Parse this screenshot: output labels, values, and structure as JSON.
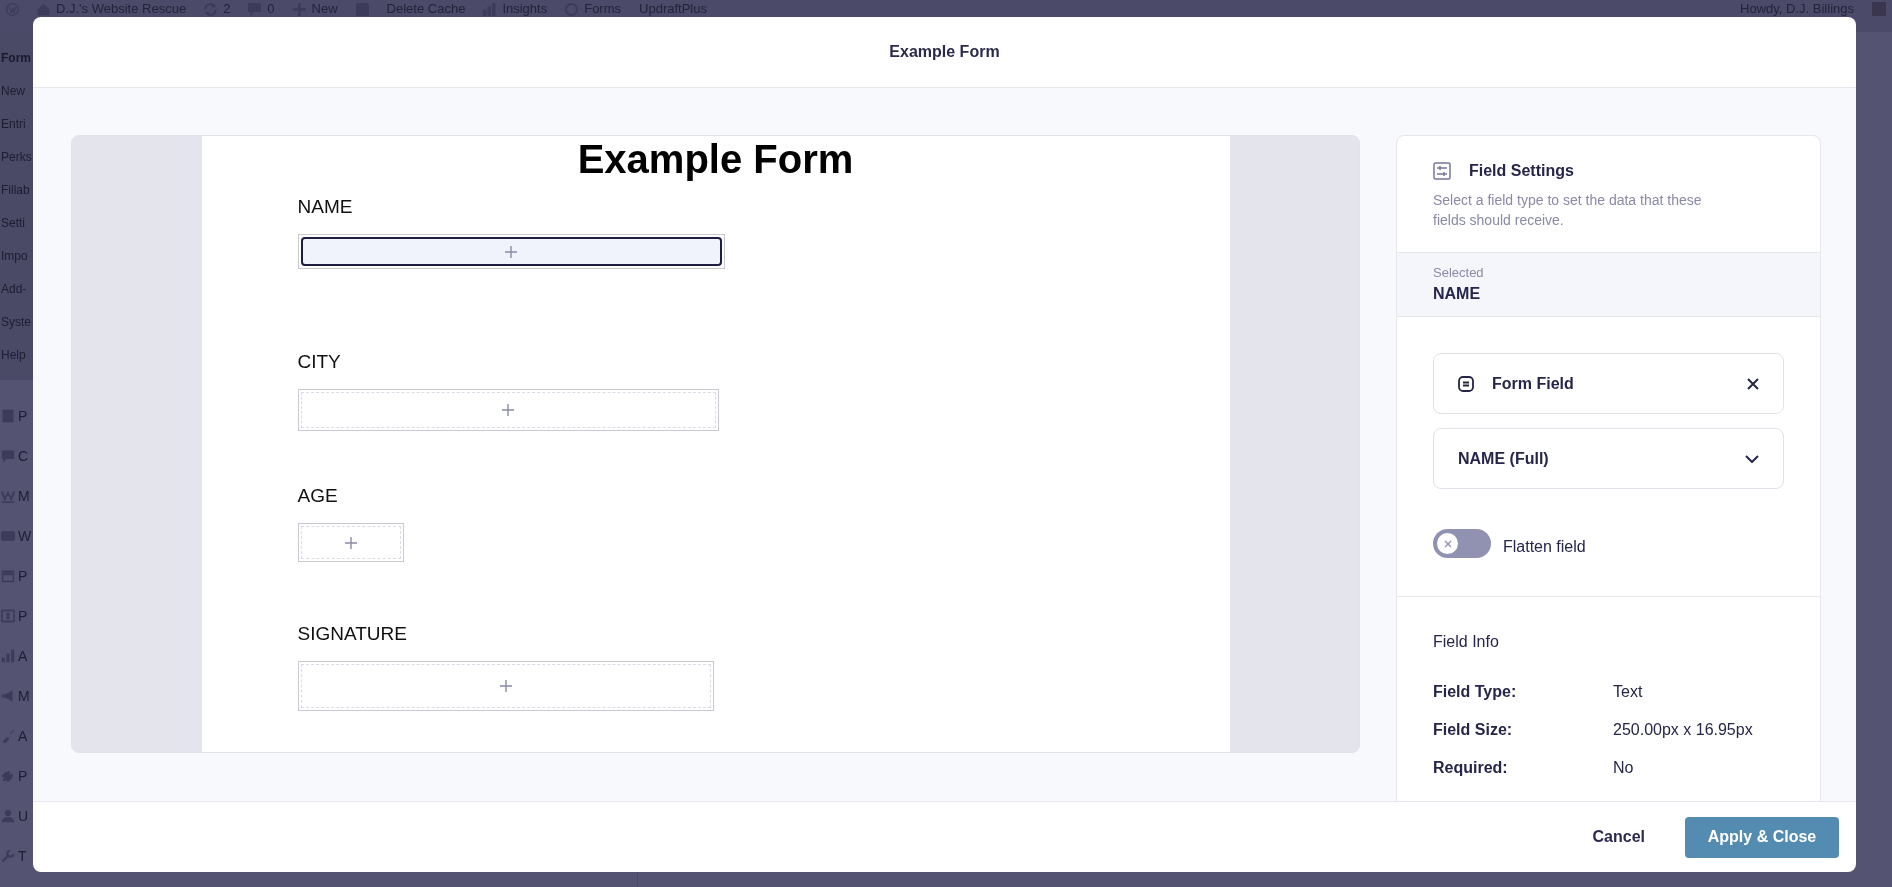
{
  "admin_bar": {
    "items": [
      {
        "kind": "wp-logo"
      },
      {
        "kind": "home",
        "label": "D.J.'s Website Rescue"
      },
      {
        "kind": "updates",
        "label": "2"
      },
      {
        "kind": "comments",
        "label": "0"
      },
      {
        "kind": "new",
        "label": "New"
      },
      {
        "kind": "seo"
      },
      {
        "kind": "text",
        "label": "Delete Cache"
      },
      {
        "kind": "insights",
        "label": "Insights"
      },
      {
        "kind": "forms",
        "label": "Forms"
      },
      {
        "kind": "text",
        "label": "UpdraftPlus"
      }
    ],
    "account": "Howdy, D.J. Billings"
  },
  "sidebar": {
    "submenu": [
      "Form",
      "New",
      "Entri",
      "Perks",
      "Fillab",
      "Setti",
      "Impo",
      "Add-",
      "Syste",
      "Help"
    ],
    "menu": [
      {
        "kind": "document",
        "label": "P"
      },
      {
        "kind": "bubble",
        "label": "C"
      },
      {
        "kind": "envelope",
        "label": "M"
      },
      {
        "kind": "shop",
        "label": "W"
      },
      {
        "kind": "box",
        "label": "P"
      },
      {
        "kind": "dollar",
        "label": "P"
      },
      {
        "kind": "bars",
        "label": "A"
      },
      {
        "kind": "megaphone",
        "label": "M"
      },
      {
        "kind": "brush",
        "label": "A"
      },
      {
        "kind": "plug",
        "label": "P"
      },
      {
        "kind": "person",
        "label": "U"
      },
      {
        "kind": "wrench",
        "label": "T"
      }
    ]
  },
  "modal": {
    "title": "Example Form",
    "document": {
      "title": "Example Form",
      "fields": [
        {
          "label": "NAME",
          "selected": true
        },
        {
          "label": "CITY",
          "selected": false
        },
        {
          "label": "AGE",
          "selected": false
        },
        {
          "label": "SIGNATURE",
          "selected": false
        }
      ]
    },
    "settings": {
      "title": "Field Settings",
      "description": "Select a field type to set the data that these fields should receive.",
      "selected_label": "Selected",
      "selected_value": "NAME",
      "field_type": "Form Field",
      "mapping": "NAME (Full)",
      "flatten": {
        "label": "Flatten field",
        "on": false
      },
      "info_title": "Field Info",
      "info": [
        {
          "label": "Field Type:",
          "value": "Text"
        },
        {
          "label": "Field Size:",
          "value": "250.00px x 16.95px"
        },
        {
          "label": "Required:",
          "value": "No"
        }
      ]
    },
    "buttons": {
      "cancel": "Cancel",
      "apply": "Apply & Close"
    }
  }
}
